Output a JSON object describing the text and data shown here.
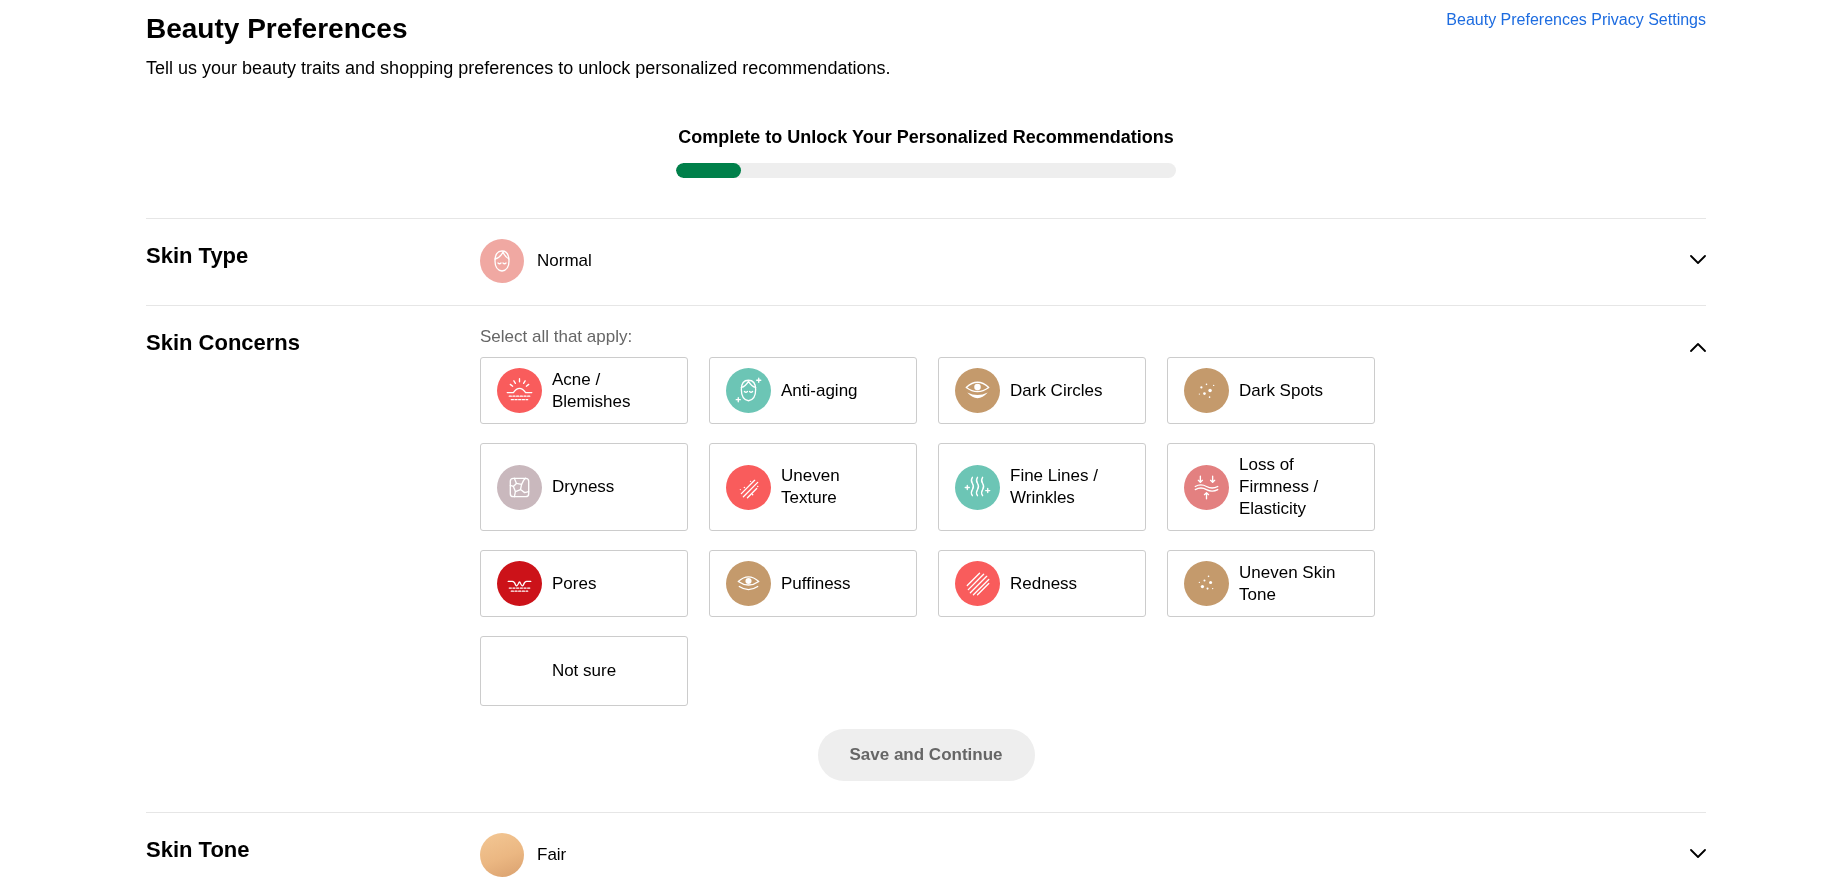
{
  "header": {
    "title": "Beauty Preferences",
    "subtitle": "Tell us your beauty traits and shopping preferences to unlock personalized recommendations.",
    "privacy_link": "Beauty Preferences Privacy Settings"
  },
  "progress": {
    "label": "Complete to Unlock Your Personalized Recommendations",
    "level": 0.13
  },
  "sections": [
    {
      "title": "Skin Type",
      "kind": "icon",
      "expanded": false,
      "value": "Normal"
    },
    {
      "title": "Skin Concerns",
      "kind": "checklist",
      "expanded": true,
      "instruction": "Select all that apply:",
      "options": [
        {
          "label": "Acne / Blemishes",
          "kind": "icon",
          "color": "#f95c5c",
          "selected": false
        },
        {
          "label": "Anti-aging",
          "kind": "icon",
          "color": "#6cc5b5",
          "selected": false
        },
        {
          "label": "Dark Circles",
          "kind": "icon",
          "color": "#c49a6c",
          "selected": false
        },
        {
          "label": "Dark Spots",
          "kind": "icon",
          "color": "#c49a6c",
          "selected": false
        },
        {
          "label": "Dryness",
          "kind": "icon",
          "color": "#c9b8bd",
          "selected": false
        },
        {
          "label": "Uneven Texture",
          "kind": "icon",
          "color": "#f95c5c",
          "selected": false
        },
        {
          "label": "Fine Lines / Wrinkles",
          "kind": "icon",
          "color": "#6cc5b5",
          "selected": false
        },
        {
          "label": "Loss of Firmness / Elasticity",
          "kind": "icon",
          "color": "#e38080",
          "selected": false
        },
        {
          "label": "Pores",
          "kind": "icon",
          "color": "#cc1219",
          "selected": false
        },
        {
          "label": "Puffiness",
          "kind": "icon",
          "color": "#c49a6c",
          "selected": false
        },
        {
          "label": "Redness",
          "kind": "icon",
          "color": "#f95c5c",
          "selected": false
        },
        {
          "label": "Uneven Skin Tone",
          "kind": "icon",
          "color": "#c49a6c",
          "selected": false
        },
        {
          "label": "Not sure",
          "kind": "text",
          "selected": false
        }
      ],
      "save_button": {
        "label": "Save and Continue",
        "disabled": true
      }
    },
    {
      "title": "Skin Tone",
      "kind": "swatch",
      "expanded": false,
      "value": "Fair"
    }
  ]
}
